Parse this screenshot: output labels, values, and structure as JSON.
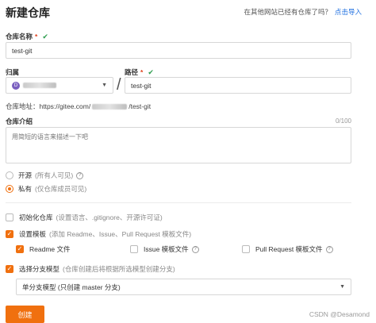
{
  "header": {
    "title": "新建仓库",
    "import_prompt": "在其他网站已经有仓库了吗？",
    "import_link": "点击导入"
  },
  "repo_name": {
    "label": "仓库名称",
    "required_mark": "*",
    "valid_mark": "✔",
    "value": "test-git"
  },
  "owner": {
    "label": "归属",
    "avatar_initial": "D"
  },
  "path": {
    "label": "路径",
    "required_mark": "*",
    "valid_mark": "✔",
    "separator": "/",
    "value": "test-git"
  },
  "repo_url": {
    "prefix": "仓库地址：https://gitee.com/",
    "suffix": "/test-git"
  },
  "description": {
    "label": "仓库介绍",
    "counter": "0/100",
    "placeholder": "用简短的语言来描述一下吧"
  },
  "visibility": {
    "public_label": "开源",
    "public_hint": "(所有人可见)",
    "private_label": "私有",
    "private_hint": "(仅仓库成员可见)",
    "selected": "private"
  },
  "init_repo": {
    "label": "初始化仓库",
    "hint": "(设置语言、.gitignore、开源许可证)",
    "checked": false
  },
  "template": {
    "label": "设置模板",
    "hint": "(添加 Readme、Issue、Pull Request 模板文件)",
    "checked": true,
    "options": [
      {
        "label": "Readme 文件",
        "checked": true
      },
      {
        "label": "Issue 模板文件",
        "checked": false
      },
      {
        "label": "Pull Request 模板文件",
        "checked": false
      }
    ]
  },
  "branch_model": {
    "label": "选择分支模型",
    "hint": "(仓库创建后将根据所选模型创建分支)",
    "checked": true,
    "selected": "单分支模型 (只创建 master 分支)"
  },
  "create_button": "创建",
  "watermark": "CSDN @Desamond",
  "colors": {
    "accent": "#f0700f",
    "link": "#1e6fe0",
    "valid": "#2e9d4f",
    "required": "#e0411c"
  }
}
